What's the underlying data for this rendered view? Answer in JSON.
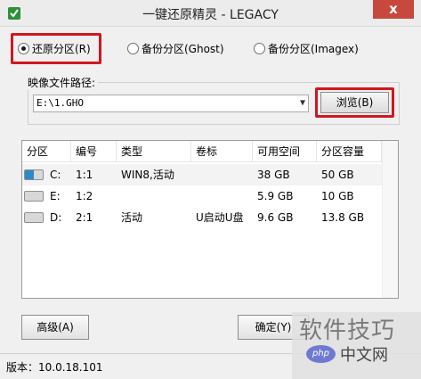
{
  "window": {
    "title": "一键还原精灵 - LEGACY",
    "close_label": "x"
  },
  "options": {
    "restore": "还原分区(R)",
    "backup_ghost": "备份分区(Ghost)",
    "backup_imagex": "备份分区(Imagex)",
    "selected": "restore"
  },
  "image_path": {
    "legend": "映像文件路径:",
    "value": "E:\\1.GHO",
    "browse_label": "浏览(B)"
  },
  "partition_table": {
    "headers": [
      "分区",
      "编号",
      "类型",
      "卷标",
      "可用空间",
      "分区容量"
    ],
    "rows": [
      {
        "drive": "C:",
        "number": "1:1",
        "type": "WIN8,活动",
        "label": "",
        "free": "38 GB",
        "capacity": "50 GB",
        "icon": "windows-drive-icon",
        "selected": true
      },
      {
        "drive": "E:",
        "number": "1:2",
        "type": "",
        "label": "",
        "free": "5.9 GB",
        "capacity": "10 GB",
        "icon": "drive-icon",
        "selected": false
      },
      {
        "drive": "D:",
        "number": "2:1",
        "type": "活动",
        "label": "U启动U盘",
        "free": "9.6 GB",
        "capacity": "13.8 GB",
        "icon": "drive-icon",
        "selected": false
      }
    ]
  },
  "buttons": {
    "advanced": "高级(A)",
    "ok": "确定(Y)"
  },
  "status": {
    "version": "版本：10.0.18.101"
  },
  "watermark": {
    "text": "软件技巧",
    "badge": "php",
    "site": "中文网"
  },
  "colors": {
    "highlight_border": "#d0171e",
    "close_button": "#c7483d"
  }
}
